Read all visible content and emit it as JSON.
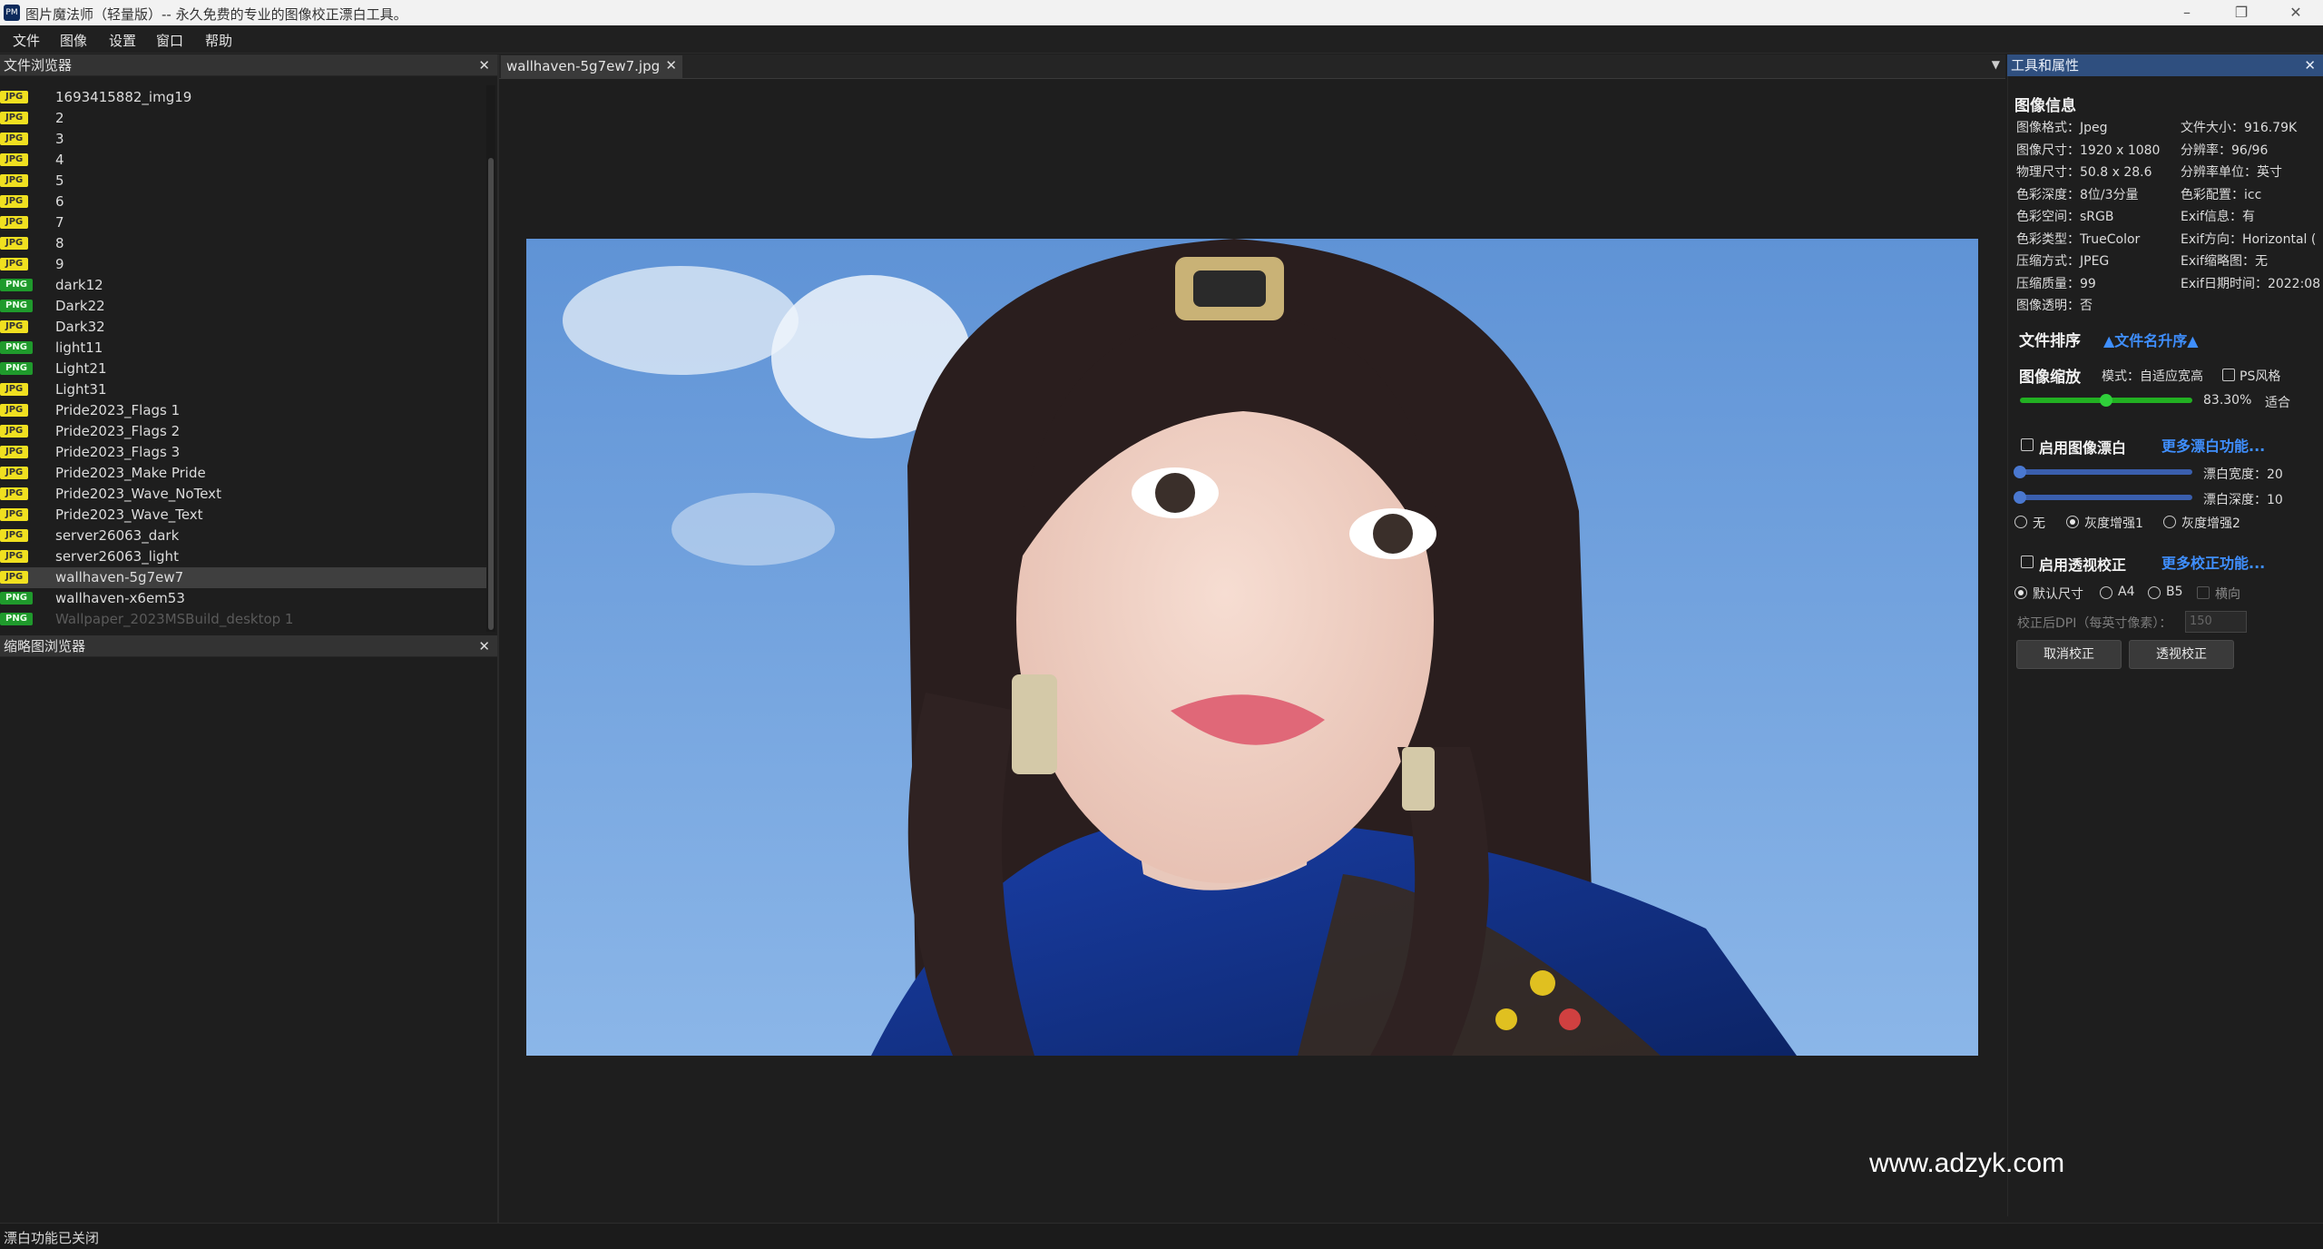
{
  "window": {
    "title": "图片魔法师（轻量版）-- 永久免费的专业的图像校正漂白工具。",
    "app_icon": "PM",
    "minimize_glyph": "–",
    "maximize_glyph": "❐",
    "close_glyph": "✕"
  },
  "menu": [
    "文件",
    "图像",
    "设置",
    "窗口",
    "帮助"
  ],
  "file_browser": {
    "title": "文件浏览器",
    "close": "✕",
    "files": [
      {
        "name": "1693415882_img19",
        "type": "JPG"
      },
      {
        "name": "2",
        "type": "JPG"
      },
      {
        "name": "3",
        "type": "JPG"
      },
      {
        "name": "4",
        "type": "JPG"
      },
      {
        "name": "5",
        "type": "JPG"
      },
      {
        "name": "6",
        "type": "JPG"
      },
      {
        "name": "7",
        "type": "JPG"
      },
      {
        "name": "8",
        "type": "JPG"
      },
      {
        "name": "9",
        "type": "JPG"
      },
      {
        "name": "dark12",
        "type": "PNG"
      },
      {
        "name": "Dark22",
        "type": "PNG"
      },
      {
        "name": "Dark32",
        "type": "JPG"
      },
      {
        "name": "light11",
        "type": "PNG"
      },
      {
        "name": "Light21",
        "type": "PNG"
      },
      {
        "name": "Light31",
        "type": "JPG"
      },
      {
        "name": "Pride2023_Flags 1",
        "type": "JPG"
      },
      {
        "name": "Pride2023_Flags 2",
        "type": "JPG"
      },
      {
        "name": "Pride2023_Flags 3",
        "type": "JPG"
      },
      {
        "name": "Pride2023_Make Pride",
        "type": "JPG"
      },
      {
        "name": "Pride2023_Wave_NoText",
        "type": "JPG"
      },
      {
        "name": "Pride2023_Wave_Text",
        "type": "JPG"
      },
      {
        "name": "server26063_dark",
        "type": "JPG"
      },
      {
        "name": "server26063_light",
        "type": "JPG"
      },
      {
        "name": "wallhaven-5g7ew7",
        "type": "JPG",
        "selected": true
      },
      {
        "name": "wallhaven-x6em53",
        "type": "PNG"
      },
      {
        "name": "Wallpaper_2023MSBuild_desktop 1",
        "type": "PNG",
        "dim": true
      }
    ]
  },
  "thumb_browser": {
    "title": "缩略图浏览器",
    "close": "✕"
  },
  "tabs": {
    "active_label": "wallhaven-5g7ew7.jpg",
    "close": "✕",
    "dropdown": "▼"
  },
  "tools_panel": {
    "title": "工具和属性",
    "close": "✕",
    "image_info_title": "图像信息",
    "info_left": [
      "图像格式：Jpeg",
      "图像尺寸：1920 x 1080",
      "物理尺寸：50.8 x 28.6",
      "色彩深度：8位/3分量",
      "色彩空间：sRGB",
      "色彩类型：TrueColor",
      "压缩方式：JPEG",
      "压缩质量：99",
      "图像透明：否"
    ],
    "info_right": [
      "文件大小：916.79K",
      "分辨率：96/96",
      "分辨率单位：英寸",
      "色彩配置：icc",
      "Exif信息：有",
      "Exif方向：Horizontal (",
      "Exif缩略图：无",
      "Exif日期时间：2022:08"
    ],
    "sort_title": "文件排序",
    "sort_value": "▲文件名升序▲",
    "zoom_title": "图像缩放",
    "zoom_mode": "模式：自适应宽高",
    "ps_style": "PS风格",
    "zoom_value": "83.30%",
    "zoom_fit": "适合",
    "zoom_fraction": 0.5,
    "whiten_enable": "启用图像漂白",
    "whiten_more": "更多漂白功能...",
    "whiten_width_label": "漂白宽度：20",
    "whiten_depth_label": "漂白深度：10",
    "whiten_width_fraction": 0.0,
    "whiten_depth_fraction": 0.0,
    "gray_options": [
      "无",
      "灰度增强1",
      "灰度增强2"
    ],
    "gray_selected": 1,
    "persp_enable": "启用透视校正",
    "persp_more": "更多校正功能...",
    "size_options": [
      "默认尺寸",
      "A4",
      "B5"
    ],
    "size_selected": 0,
    "landscape": "横向",
    "dpi_label": "校正后DPI（每英寸像素）：",
    "dpi_value": "150",
    "cancel_btn": "取消校正",
    "persp_btn": "透视校正"
  },
  "status": {
    "text": "漂白功能已关闭"
  },
  "watermark": "www.adzyk.com",
  "colors": {
    "accent": "#2f4f7f",
    "link": "#3f8fff",
    "jpg_badge": "#f0e020",
    "png_badge": "#1f9a2c",
    "zoom_slider": "#22b022"
  }
}
